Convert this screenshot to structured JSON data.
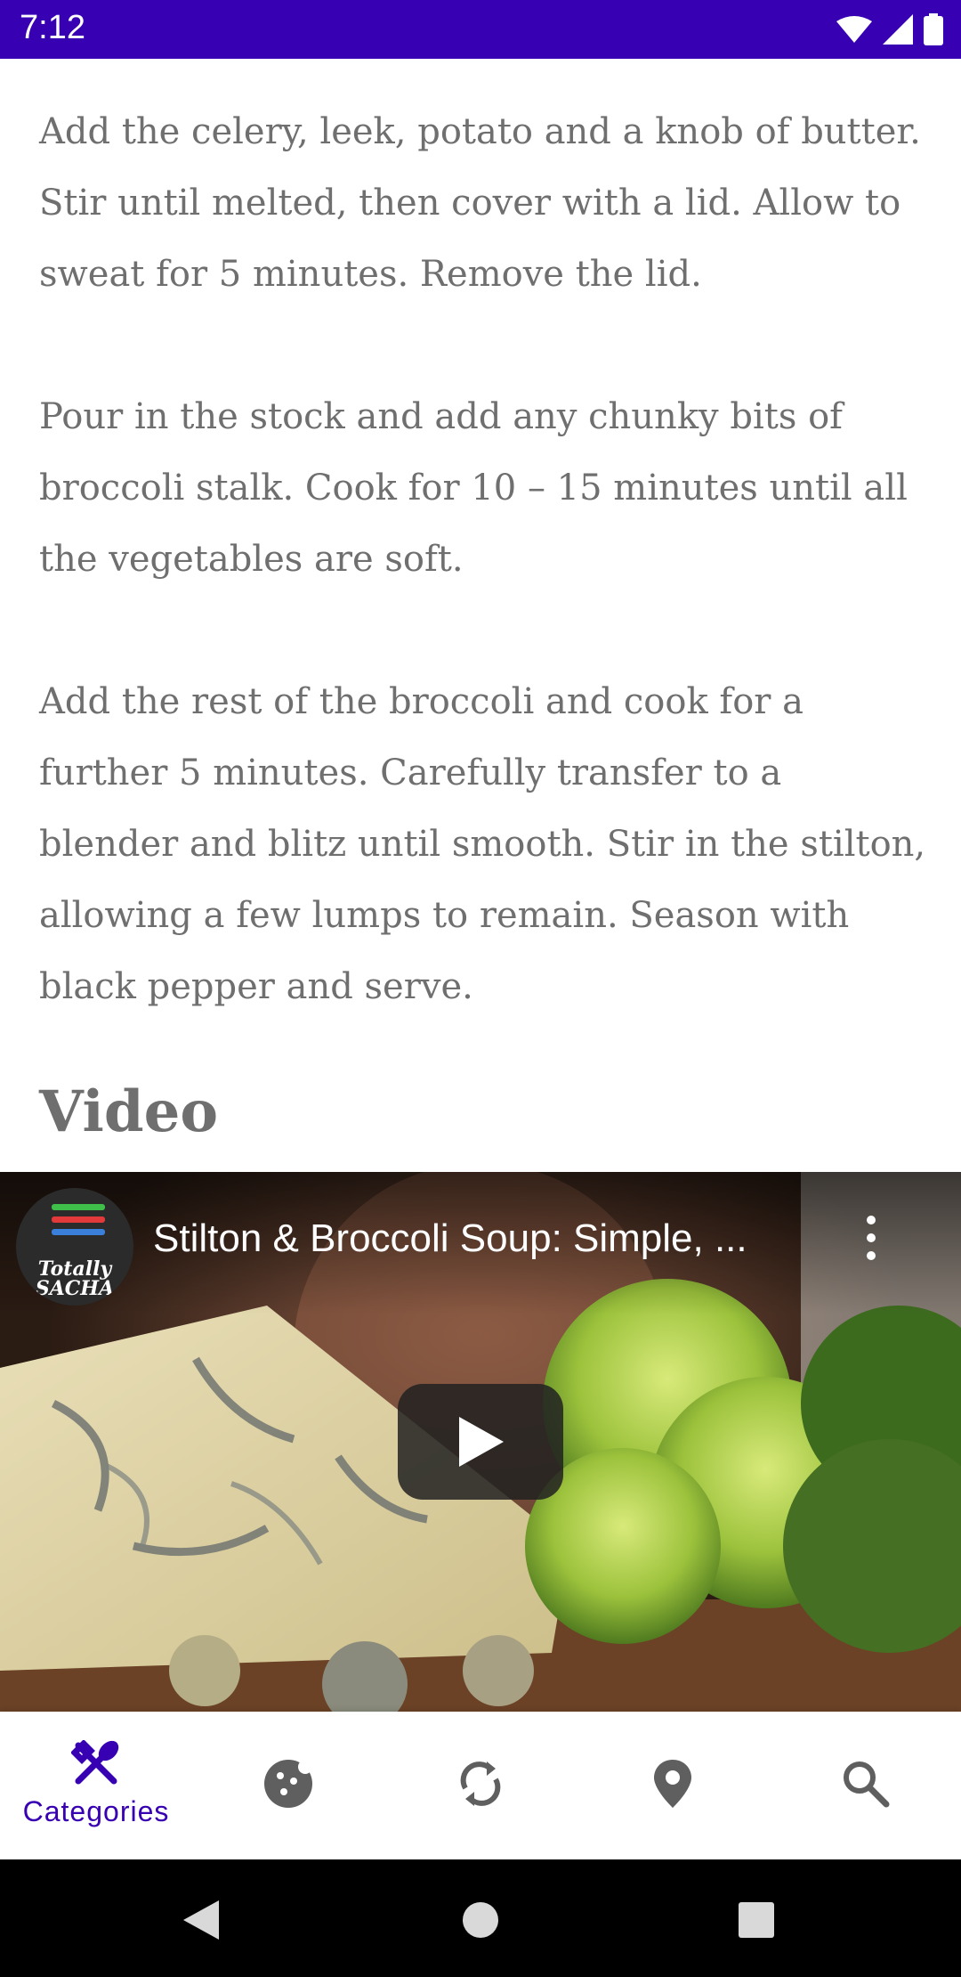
{
  "status_bar": {
    "time": "7:12",
    "icons": [
      "wifi-icon",
      "signal-icon",
      "battery-icon"
    ],
    "background": "#3700b3"
  },
  "recipe": {
    "paragraphs": [
      "Add the celery, leek, potato and a knob of butter. Stir until melted, then cover with a lid. Allow to sweat for 5 minutes. Remove the lid.",
      "Pour in the stock and add any chunky bits of broccoli stalk. Cook for 10 – 15 minutes until all the vegetables are soft.",
      "Add the rest of the broccoli and cook for a further 5 minutes. Carefully transfer to a blender and blitz until smooth. Stir in the stilton, allowing a few lumps to remain. Season with black pepper and serve."
    ],
    "video_section_title": "Video"
  },
  "video": {
    "title": "Stilton & Broccoli Soup: Simple, ...",
    "channel_logo_text": "Totally SACHA",
    "icons": [
      "channel-avatar",
      "more-vert-icon",
      "play-icon"
    ]
  },
  "bottom_nav": {
    "accent": "#3700b3",
    "inactive_color": "#5f5f5f",
    "items": [
      {
        "label": "Categories",
        "icon": "fork-spoon-icon",
        "active": true
      },
      {
        "label": "",
        "icon": "cookie-icon",
        "active": false
      },
      {
        "label": "",
        "icon": "sync-icon",
        "active": false
      },
      {
        "label": "",
        "icon": "location-pin-icon",
        "active": false
      },
      {
        "label": "",
        "icon": "search-icon",
        "active": false
      }
    ]
  },
  "system_nav": {
    "icons": [
      "back-icon",
      "home-icon",
      "recents-icon"
    ]
  }
}
